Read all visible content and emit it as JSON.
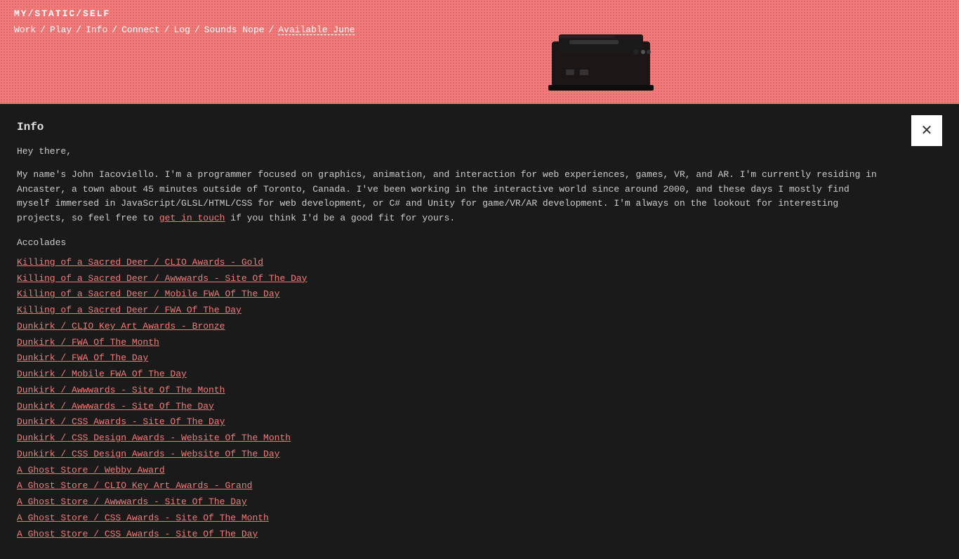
{
  "site": {
    "title": "MY/STATIC/SELF"
  },
  "nav": {
    "items": [
      {
        "label": "Work",
        "href": "#work"
      },
      {
        "label": "Play",
        "href": "#play"
      },
      {
        "label": "Info",
        "href": "#info"
      },
      {
        "label": "Connect",
        "href": "#connect"
      },
      {
        "label": "Log",
        "href": "#log"
      },
      {
        "label": "Sounds Nope",
        "href": "#sounds"
      },
      {
        "label": "Available June",
        "href": "#available",
        "special": true
      }
    ],
    "separator": "/"
  },
  "page": {
    "heading": "Info",
    "hey_there": "Hey there,",
    "bio": "My name's John Iacoviello. I'm a programmer focused on graphics, animation, and interaction for web experiences, games, VR, and AR. I'm currently residing in Ancaster, a town about 45 minutes outside of Toronto, Canada. I've been working in the interactive world since around 2000, and these days I mostly find myself immersed in JavaScript/GLSL/HTML/CSS for web development, or C# and Unity for game/VR/AR development. I'm always on the lookout for interesting projects, so feel free to",
    "bio_link_text": "get in touch",
    "bio_end": "if you think I'd be a good fit for yours.",
    "accolades_heading": "Accolades",
    "accolades": [
      "Killing of a Sacred Deer / CLIO Awards - Gold",
      "Killing of a Sacred Deer / Awwwards - Site Of The Day",
      "Killing of a Sacred Deer / Mobile FWA Of The Day",
      "Killing of a Sacred Deer / FWA Of The Day",
      "Dunkirk / CLIO Key Art Awards - Bronze",
      "Dunkirk / FWA Of The Month",
      "Dunkirk / FWA Of The Day",
      "Dunkirk / Mobile FWA Of The Day",
      "Dunkirk / Awwwards - Site Of The Month",
      "Dunkirk / Awwwards - Site Of The Day",
      "Dunkirk / CSS Awards - Site Of The Day",
      "Dunkirk / CSS Design Awards - Website Of The Month",
      "Dunkirk / CSS Design Awards - Website Of The Day",
      "A Ghost Store / Webby Award",
      "A Ghost Store / CLIO Key Art Awards - Grand",
      "A Ghost Store / Awwwards - Site Of The Day",
      "A Ghost Store / CSS Awards - Site Of The Month",
      "A Ghost Store / CSS Awards - Site Of The Day"
    ]
  },
  "colors": {
    "accent": "#f47a7a",
    "bg": "#1a1a1a",
    "header_bg": "#f47a7a",
    "text": "#ccc",
    "close_bg": "#ffffff"
  }
}
